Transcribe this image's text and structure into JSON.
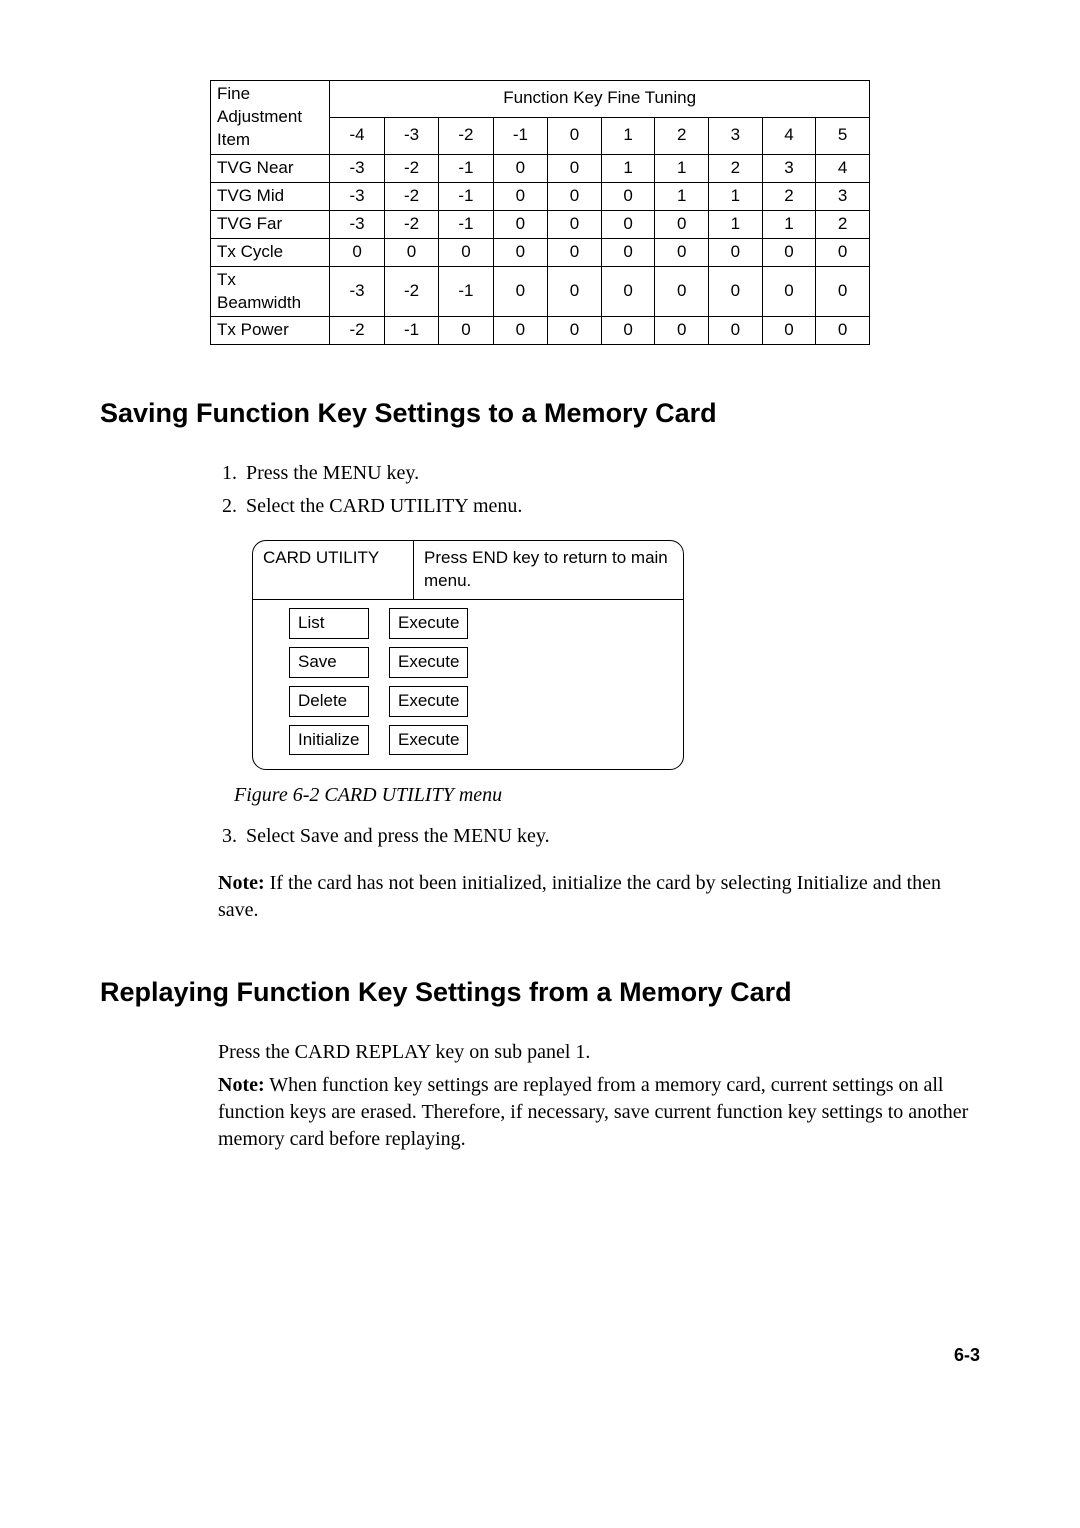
{
  "chart_data": {
    "type": "table",
    "title": "Function Key Fine Tuning",
    "row_header_lines": [
      "Fine",
      "Adjustment",
      "Item"
    ],
    "columns": [
      "-4",
      "-3",
      "-2",
      "-1",
      "0",
      "1",
      "2",
      "3",
      "4",
      "5"
    ],
    "rows": [
      {
        "name": "TVG Near",
        "values": [
          "-3",
          "-2",
          "-1",
          "0",
          "0",
          "1",
          "1",
          "2",
          "3",
          "4"
        ]
      },
      {
        "name": "TVG Mid",
        "values": [
          "-3",
          "-2",
          "-1",
          "0",
          "0",
          "0",
          "1",
          "1",
          "2",
          "3"
        ]
      },
      {
        "name": "TVG Far",
        "values": [
          "-3",
          "-2",
          "-1",
          "0",
          "0",
          "0",
          "0",
          "1",
          "1",
          "2"
        ]
      },
      {
        "name": "Tx Cycle",
        "values": [
          "0",
          "0",
          "0",
          "0",
          "0",
          "0",
          "0",
          "0",
          "0",
          "0"
        ]
      },
      {
        "name": "Tx Beamwidth",
        "values": [
          "-3",
          "-2",
          "-1",
          "0",
          "0",
          "0",
          "0",
          "0",
          "0",
          "0"
        ]
      },
      {
        "name": "Tx Power",
        "values": [
          "-2",
          "-1",
          "0",
          "0",
          "0",
          "0",
          "0",
          "0",
          "0",
          "0"
        ]
      }
    ]
  },
  "headings": {
    "saving": "Saving Function Key Settings to a Memory Card",
    "replaying": "Replaying Function Key Settings from a Memory Card"
  },
  "saving_steps": {
    "s1": "Press the MENU key.",
    "s2": "Select the CARD UTILITY menu.",
    "s3": "Select Save and press the MENU key."
  },
  "card_utility": {
    "title": "CARD UTILITY",
    "hint": "Press END key to return to main menu.",
    "execute_label": "Execute",
    "items": [
      "List",
      "Save",
      "Delete",
      "Initialize"
    ],
    "caption": "Figure 6-2 CARD UTILITY menu"
  },
  "note_label": "Note:",
  "saving_note": " If the card has not been initialized, initialize the card by selecting Initialize and then save.",
  "replaying_text": "Press the CARD REPLAY key on sub panel 1.",
  "replaying_note": " When function key settings are replayed from a memory card, current settings on all function keys are erased. Therefore, if necessary, save current function key settings to another memory card before replaying.",
  "page_number": "6-3"
}
